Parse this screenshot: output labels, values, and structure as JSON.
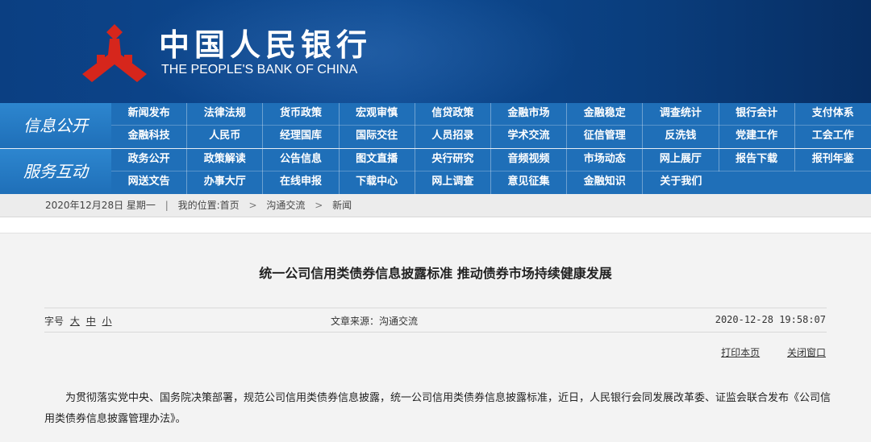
{
  "header": {
    "logo_cn": "中国人民银行",
    "logo_en": "THE PEOPLE'S BANK OF CHINA",
    "emblem_color": "#d6261c"
  },
  "nav": {
    "info": {
      "label": "信息公开",
      "row1": [
        "新闻发布",
        "法律法规",
        "货币政策",
        "宏观审慎",
        "信贷政策",
        "金融市场",
        "金融稳定",
        "调查统计",
        "银行会计",
        "支付体系"
      ],
      "row2": [
        "金融科技",
        "人民币",
        "经理国库",
        "国际交往",
        "人员招录",
        "学术交流",
        "征信管理",
        "反洗钱",
        "党建工作",
        "工会工作"
      ]
    },
    "service": {
      "label": "服务互动",
      "row1": [
        "政务公开",
        "政策解读",
        "公告信息",
        "图文直播",
        "央行研究",
        "音频视频",
        "市场动态",
        "网上展厅",
        "报告下载",
        "报刊年鉴"
      ],
      "row2": [
        "网送文告",
        "办事大厅",
        "在线申报",
        "下载中心",
        "网上调查",
        "意见征集",
        "金融知识",
        "关于我们"
      ]
    },
    "color": "#1f6fb8"
  },
  "breadcrumb": {
    "date": "2020年12月28日 星期一",
    "divider": "|",
    "location_label": "我的位置:",
    "home": "首页",
    "sep": ">",
    "level1": "沟通交流",
    "level2": "新闻"
  },
  "article": {
    "title": "统一公司信用类债券信息披露标准  推动债券市场持续健康发展",
    "fontsize_label": "字号",
    "fontsize_large": "大",
    "fontsize_medium": "中",
    "fontsize_small": "小",
    "source": "文章来源：沟通交流",
    "datetime": "2020-12-28 19:58:07",
    "print_label": "打印本页",
    "close_label": "关闭窗口",
    "body": "为贯彻落实党中央、国务院决策部署，规范公司信用类债券信息披露，统一公司信用类债券信息披露标准，近日，人民银行会同发展改革委、证监会联合发布《公司信用类债券信息披露管理办法》。"
  }
}
